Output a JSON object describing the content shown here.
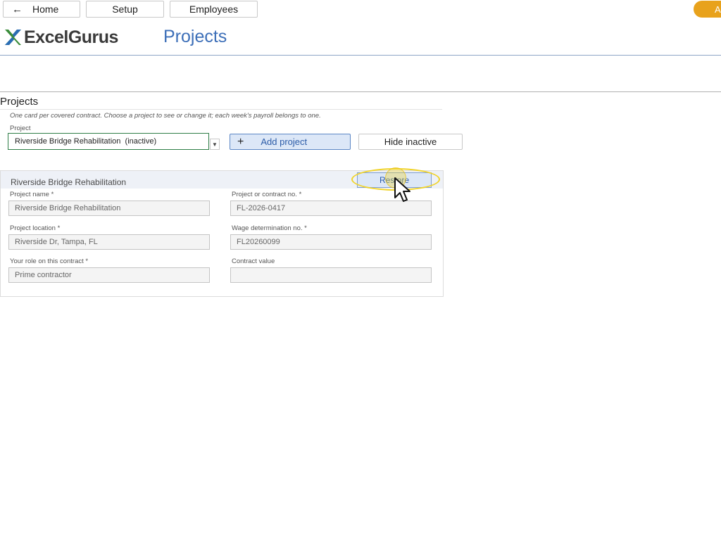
{
  "nav": {
    "home_label": "Home",
    "home_icon": "←",
    "setup_label": "Setup",
    "employees_label": "Employees",
    "accent_pill_text": "A"
  },
  "brand": {
    "logo_text": "ExcelGurus",
    "logo_colors": [
      "#3a8c3a",
      "#2a6db5"
    ]
  },
  "page": {
    "title": "Projects"
  },
  "section": {
    "title": "Projects",
    "hint": "One card per covered contract. Choose a project to see or change it; each week's payroll belongs to one.",
    "project_label": "Project",
    "project_selected": "Riverside Bridge Rehabilitation  (inactive)",
    "add_project_label": "Add project",
    "add_icon": "+",
    "hide_inactive_label": "Hide inactive"
  },
  "card": {
    "title": "Riverside Bridge Rehabilitation",
    "restore_label": "Restore",
    "fields": {
      "project_name": {
        "label": "Project name *",
        "value": "Riverside Bridge Rehabilitation"
      },
      "contract_no": {
        "label": "Project or contract no. *",
        "value": "FL-2026-0417"
      },
      "location": {
        "label": "Project location *",
        "value": "Riverside Dr, Tampa, FL"
      },
      "wage_det": {
        "label": "Wage determination no. *",
        "value": "FL20260099"
      },
      "role": {
        "label": "Your role on this contract *",
        "value": "Prime contractor"
      },
      "contract_value": {
        "label": "Contract value",
        "value": ""
      }
    }
  },
  "colors": {
    "accent": "#e8a21c",
    "primary_blue": "#3d6fb8",
    "button_fill": "#dce7f7",
    "focus_green": "#2e7d46",
    "highlight": "#f0d32a"
  }
}
